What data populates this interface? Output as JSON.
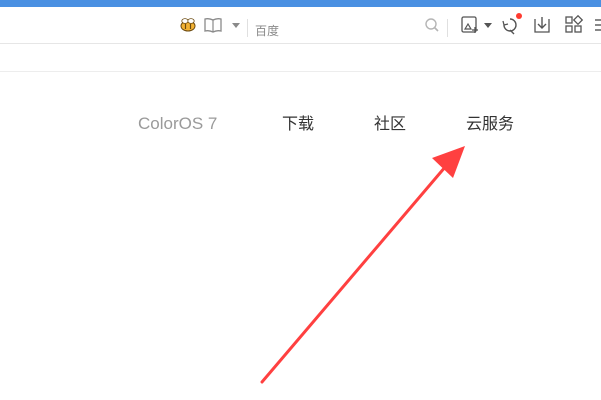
{
  "browser": {
    "search_placeholder": "百度",
    "accent_color": "#4a90e2"
  },
  "site_nav": {
    "brand": "ColorOS 7",
    "items": [
      {
        "label": "下载"
      },
      {
        "label": "社区"
      },
      {
        "label": "云服务"
      }
    ]
  },
  "annotation": {
    "arrow_color": "#ff4040",
    "points_to": "云服务"
  }
}
